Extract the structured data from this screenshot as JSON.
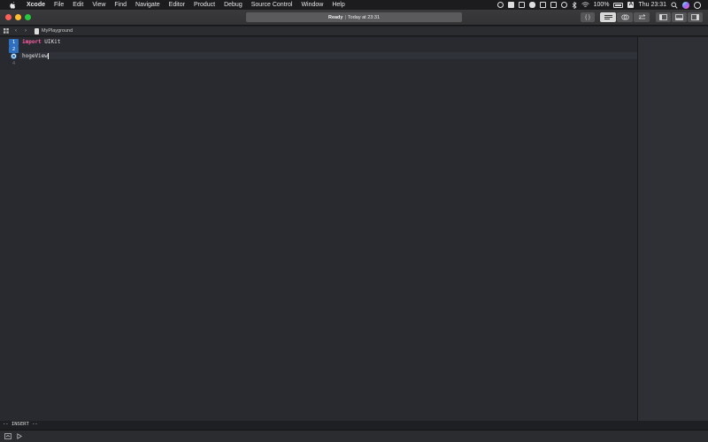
{
  "menubar": {
    "app": "Xcode",
    "items": [
      "File",
      "Edit",
      "View",
      "Find",
      "Navigate",
      "Editor",
      "Product",
      "Debug",
      "Source Control",
      "Window",
      "Help"
    ],
    "battery": "100%",
    "input_source": "A",
    "clock": "Thu 23:31"
  },
  "toolbar": {
    "status_primary": "Ready",
    "status_separator": "|",
    "status_secondary": "Today at 23:31",
    "code_button_glyph": "{ }"
  },
  "jumpbar": {
    "file_name": "MyPlayground"
  },
  "editor": {
    "line_numbers": [
      "1",
      "2",
      "",
      "4"
    ],
    "line1_keyword": "import",
    "line1_rest": " UIKit",
    "line3_text": "hogeView"
  },
  "modeline": "-- INSERT --",
  "colors": {
    "traffic_red": "#fe5f57",
    "traffic_yellow": "#febc2e",
    "traffic_green": "#28c840",
    "accent_blue": "#2f6fbf",
    "keyword": "#fc5fa3"
  }
}
